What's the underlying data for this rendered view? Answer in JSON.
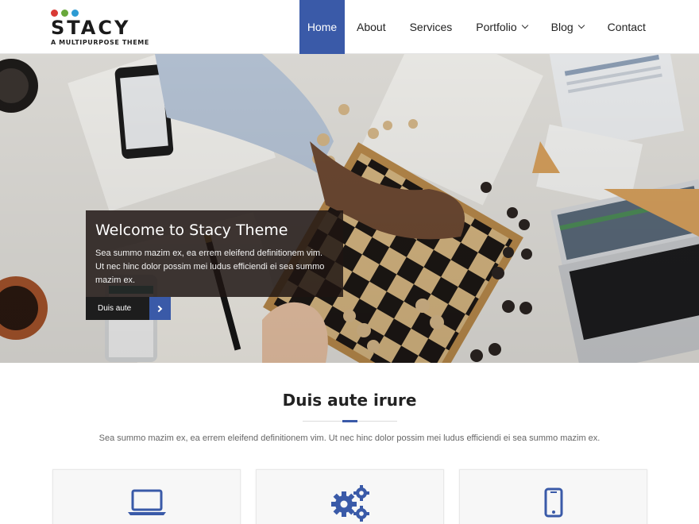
{
  "brand": {
    "name": "STACY",
    "tagline": "A MULTIPURPOSE THEME",
    "dot_colors": [
      "#d93a35",
      "#69a83b",
      "#2d9bd3"
    ]
  },
  "nav": {
    "items": [
      {
        "label": "Home",
        "active": true,
        "dropdown": false
      },
      {
        "label": "About",
        "active": false,
        "dropdown": false
      },
      {
        "label": "Services",
        "active": false,
        "dropdown": false
      },
      {
        "label": "Portfolio",
        "active": false,
        "dropdown": true
      },
      {
        "label": "Blog",
        "active": false,
        "dropdown": true
      },
      {
        "label": "Contact",
        "active": false,
        "dropdown": false
      }
    ]
  },
  "hero": {
    "title": "Welcome to Stacy Theme",
    "text": "Sea summo mazim ex, ea errem eleifend definitionem vim. Ut nec hinc dolor possim mei ludus efficiendi ei sea summo mazim ex.",
    "button_label": "Duis aute",
    "button_icon": "chevron-right-icon"
  },
  "section": {
    "title": "Duis aute irure",
    "description": "Sea summo mazim ex, ea errem eleifend definitionem vim. Ut nec hinc dolor possim mei ludus efficiendi ei sea summo mazim ex."
  },
  "features": [
    {
      "icon": "laptop-icon"
    },
    {
      "icon": "gears-icon"
    },
    {
      "icon": "smartphone-icon"
    }
  ],
  "colors": {
    "accent": "#3a5aa8",
    "caption_bg": "#1e1412",
    "button_dark": "#1d1d1d"
  }
}
